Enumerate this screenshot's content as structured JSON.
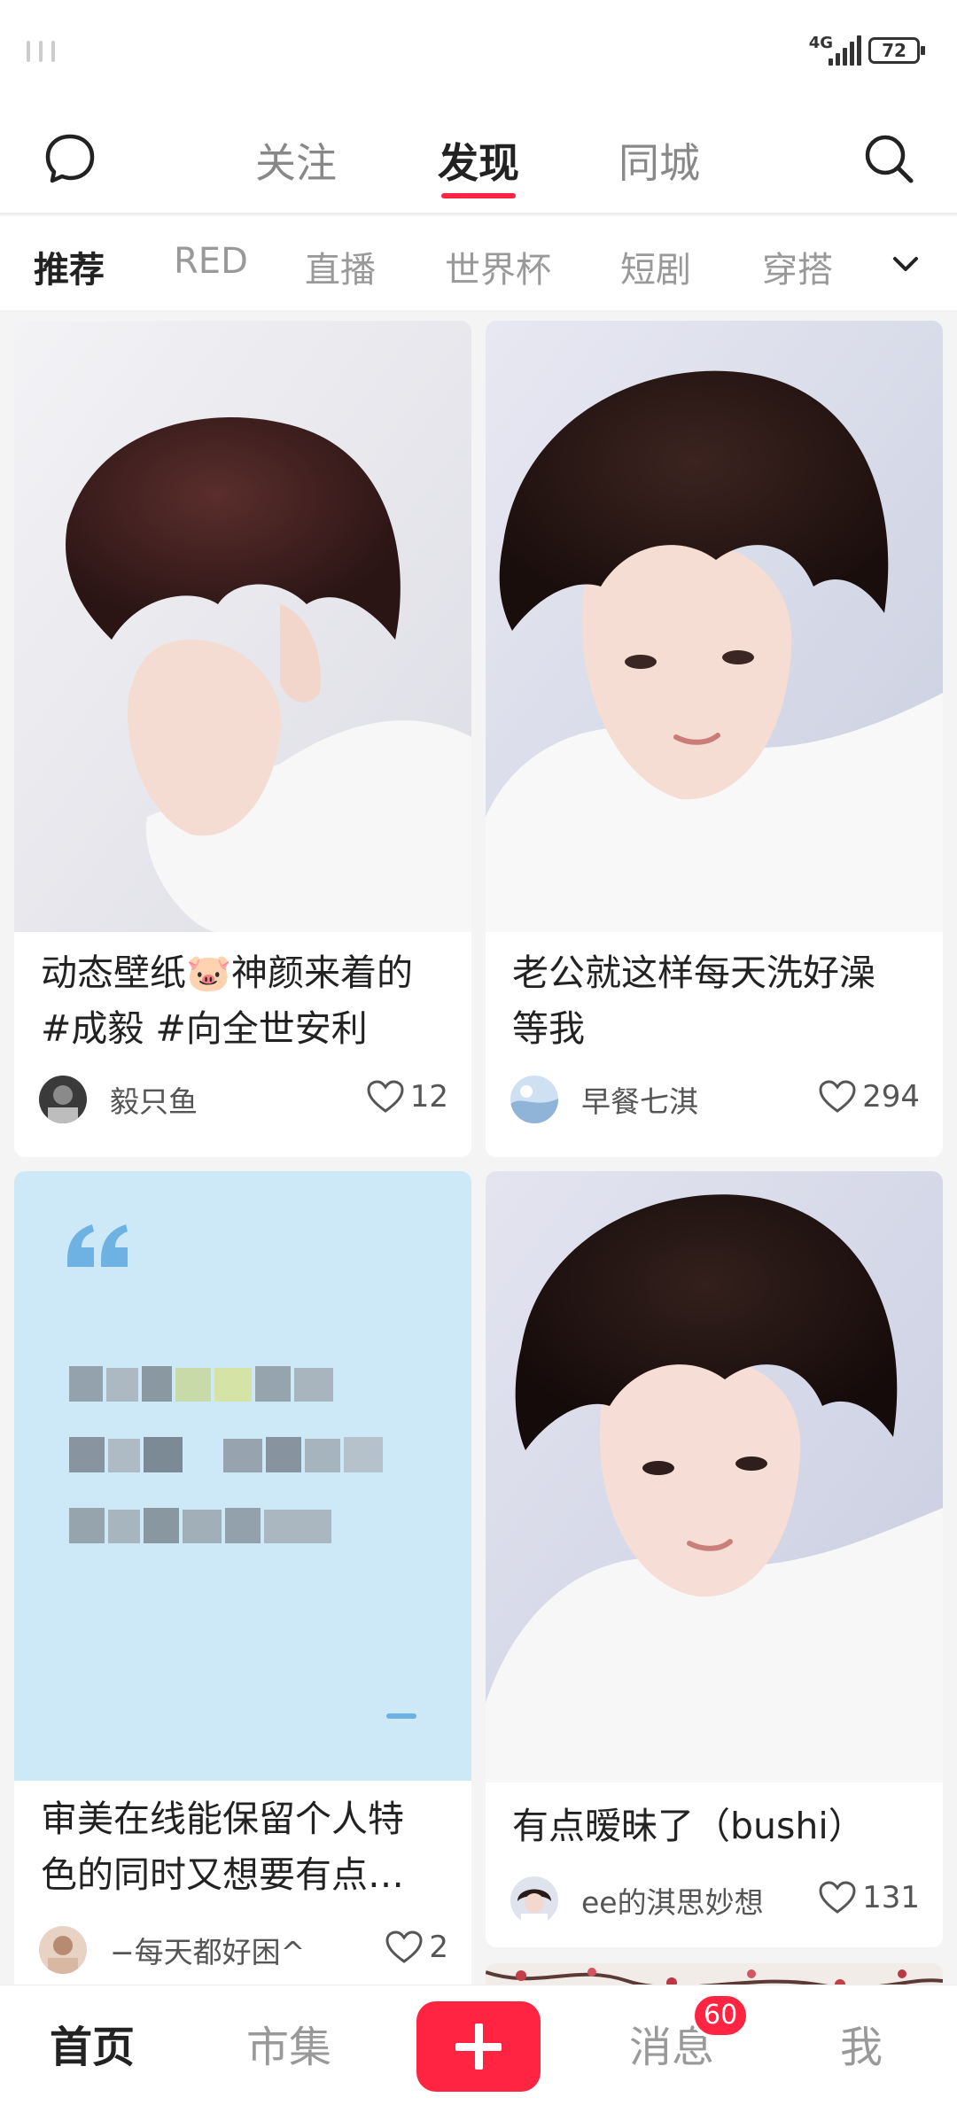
{
  "status_bar": {
    "network": "4G",
    "battery": "72"
  },
  "top_nav": {
    "tabs": [
      {
        "label": "关注"
      },
      {
        "label": "发现"
      },
      {
        "label": "同城"
      }
    ],
    "active_tab": "发现"
  },
  "categories": {
    "items": [
      "推荐",
      "RED",
      "直播",
      "世界杯",
      "短剧",
      "穿搭"
    ],
    "active": "推荐"
  },
  "feed": {
    "cards": [
      {
        "title_line1": "动态壁纸🐷神颜来着的",
        "title_line2": "#成毅 #向全世安利",
        "author": "毅只鱼",
        "likes": "12"
      },
      {
        "title_line1": "老公就这样每天洗好澡",
        "title_line2": "等我",
        "author": "早餐七淇",
        "likes": "294"
      },
      {
        "title_line1": "审美在线能保留个人特",
        "title_line2": "色的同时又想要有点…",
        "author": "−每天都好困^",
        "likes": "2"
      },
      {
        "title_line1": "有点暧昧了（bushi）",
        "author": "ee的淇思妙想",
        "likes": "131"
      }
    ]
  },
  "bottom_nav": {
    "tabs": [
      {
        "label": "首页"
      },
      {
        "label": "市集"
      },
      {
        "label": "消息"
      },
      {
        "label": "我"
      }
    ],
    "active_tab": "首页",
    "messages_badge": "60"
  },
  "colors": {
    "accent": "#ff2442",
    "background": "#f4f4f4",
    "card": "#ffffff"
  }
}
